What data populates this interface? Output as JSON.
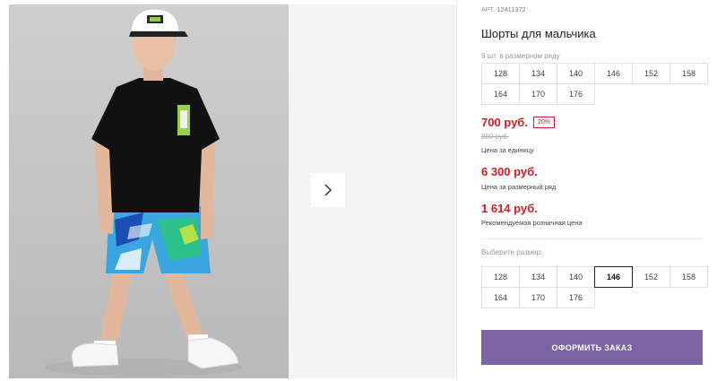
{
  "product": {
    "art_label": "АРТ.",
    "art_number": "12411372",
    "title": "Шорты для мальчика",
    "pack_note": "9 шт. в размерном ряду",
    "pack_sizes": [
      "128",
      "134",
      "140",
      "146",
      "152",
      "158",
      "164",
      "170",
      "176"
    ]
  },
  "pricing": {
    "price": "700 руб.",
    "discount": "20%",
    "old_price": "880 руб.",
    "unit_label": "Цена за единицу",
    "row_price": "6 300 руб.",
    "row_label": "Цена за размерный ряд",
    "retail_price": "1 614 руб.",
    "retail_label": "Рекомендуемая розничная цена"
  },
  "size_select": {
    "label": "Выберите размер:",
    "options": [
      "128",
      "134",
      "140",
      "146",
      "152",
      "158",
      "164",
      "170",
      "176"
    ],
    "selected": "146"
  },
  "actions": {
    "order_label": "ОФОРМИТЬ ЗАКАЗ"
  },
  "gallery": {
    "next_icon": "chevron-right-icon"
  },
  "colors": {
    "accent_purple": "#7b64a3",
    "price_red": "#d31b27"
  }
}
